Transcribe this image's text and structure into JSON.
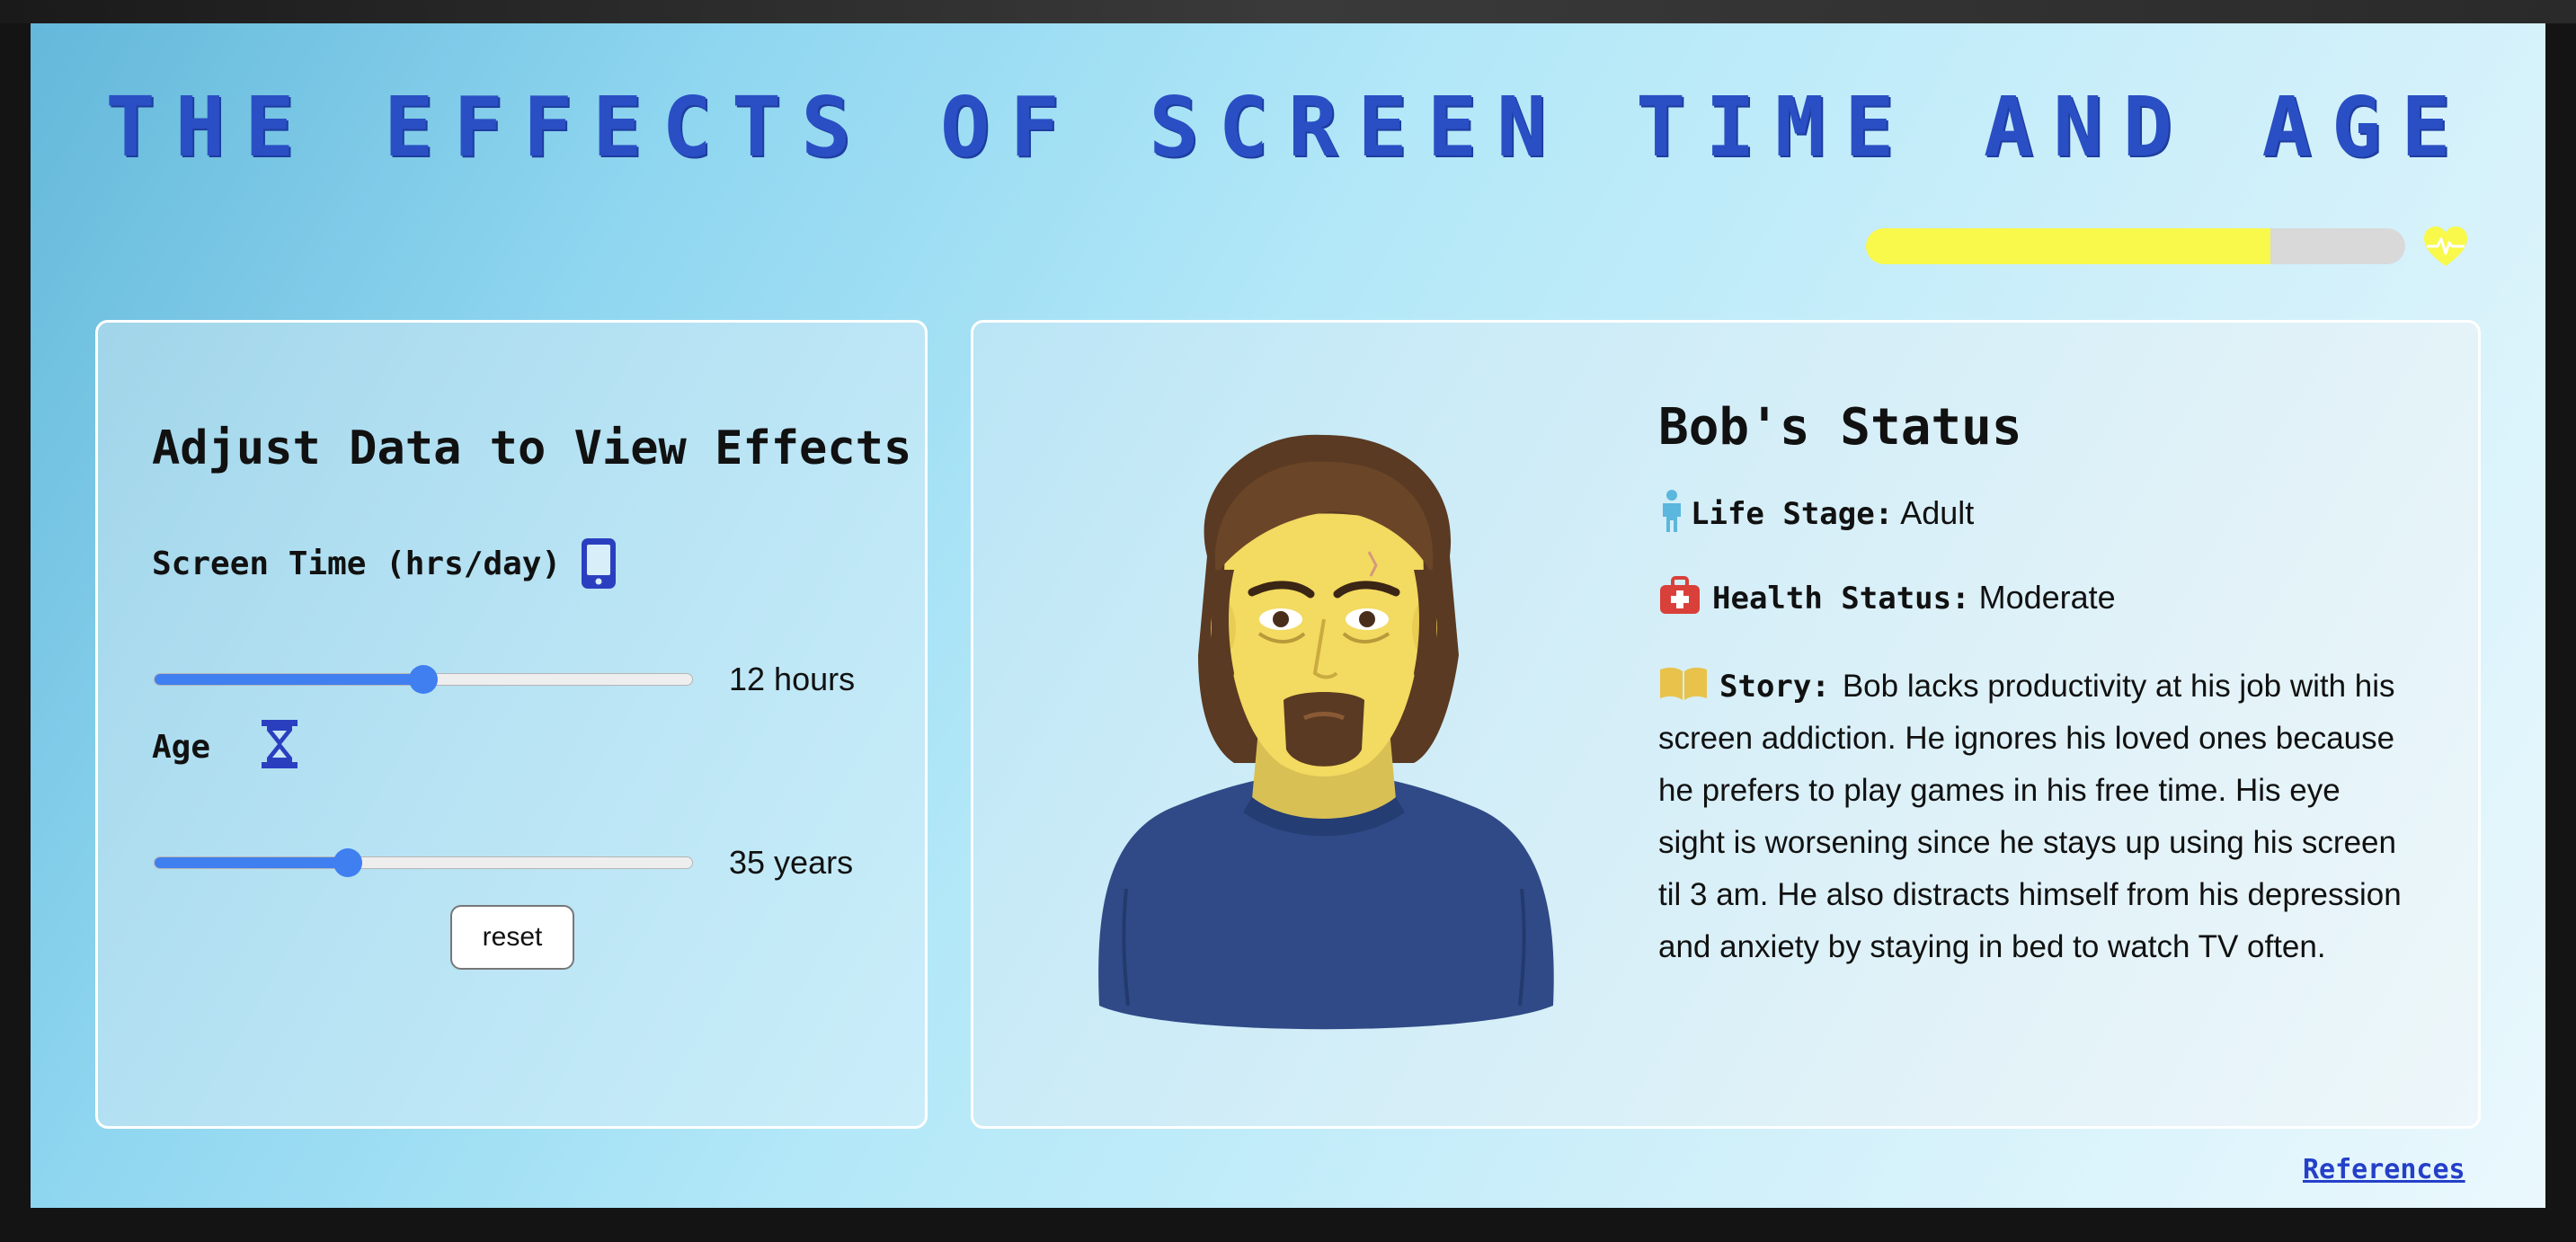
{
  "header": {
    "title": "THE EFFECTS OF SCREEN TIME AND AGE"
  },
  "health_bar": {
    "level": 0.75,
    "fill_color": "#f9f94b",
    "track_color": "#d9d9d9",
    "icon": "heart-pulse-icon"
  },
  "controls": {
    "heading": "Adjust Data to View Effects",
    "screen_time": {
      "label": "Screen Time (hrs/day)",
      "icon": "smartphone-icon",
      "value": 12,
      "value_text": "12 hours",
      "fraction": 0.5
    },
    "age": {
      "label": "Age",
      "icon": "hourglass-icon",
      "value": 35,
      "value_text": "35 years",
      "fraction": 0.36
    },
    "reset_label": "reset"
  },
  "status": {
    "heading": "Bob's Status",
    "life_stage_key": "Life Stage:",
    "life_stage_value": "Adult",
    "health_key": "Health Status:",
    "health_value": "Moderate",
    "story_key": "Story:",
    "story_text": "Bob lacks productivity at his job with his screen addiction. He ignores his loved ones because he prefers to play games in his free time. His eye sight is worsening since he stays up using his screen til 3 am. He also distracts himself from his depression and anxiety by staying in bed to watch TV often."
  },
  "footer": {
    "references_label": "References"
  },
  "colors": {
    "accent": "#3f7ff0",
    "title": "#2a4fc4",
    "link": "#2440c8"
  }
}
